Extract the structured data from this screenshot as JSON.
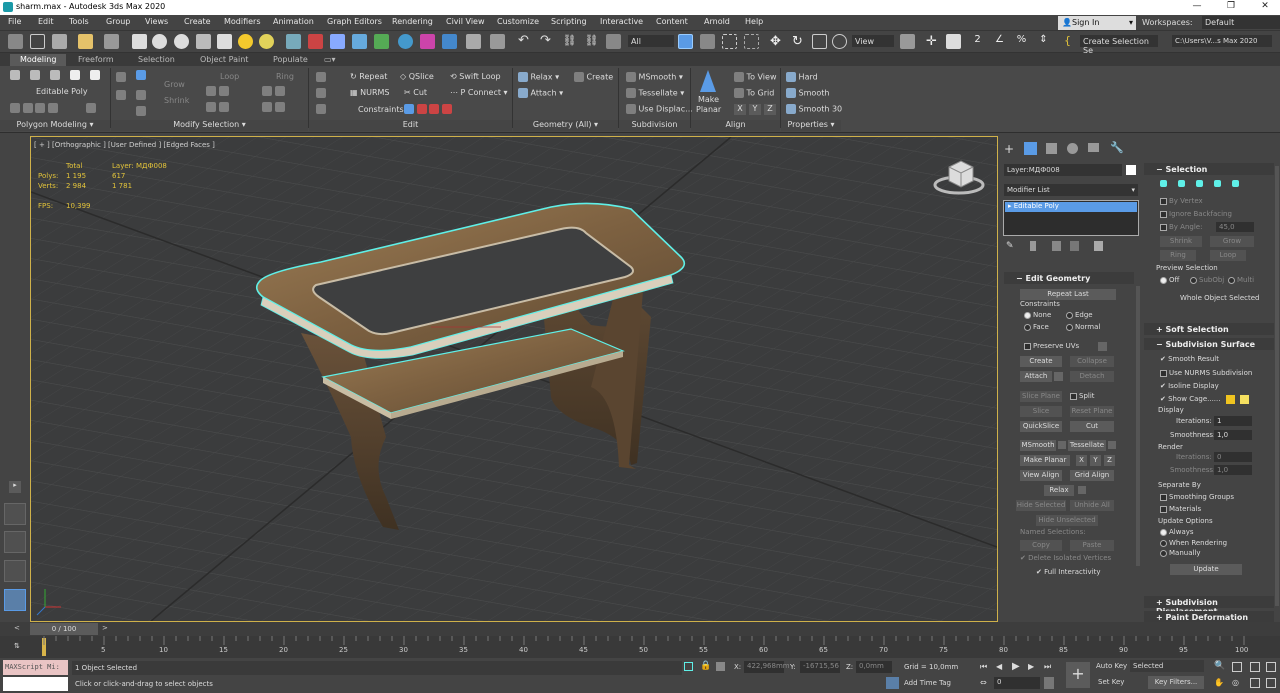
{
  "window": {
    "title": "sharm.max - Autodesk 3ds Max 2020"
  },
  "menu": [
    "File",
    "Edit",
    "Tools",
    "Group",
    "Views",
    "Create",
    "Modifiers",
    "Animation",
    "Graph Editors",
    "Rendering",
    "Civil View",
    "Customize",
    "Scripting",
    "Interactive",
    "Content",
    "Arnold",
    "Help"
  ],
  "account": {
    "sign_in": "Sign In",
    "workspaces_label": "Workspaces:",
    "workspace_value": "Default"
  },
  "toolbar": {
    "filter": "All",
    "view": "View",
    "create_selection_set": "Create Selection Se",
    "path": "C:\\Users\\V...s Max 2020"
  },
  "ribbon_tabs": [
    "Modeling",
    "Freeform",
    "Selection",
    "Object Paint",
    "Populate"
  ],
  "ribbon": {
    "object_type": "Editable Poly",
    "grow": "Grow",
    "shrink": "Shrink",
    "loop": "Loop",
    "ring": "Ring",
    "repeat": "Repeat",
    "qslice": "QSlice",
    "swift_loop": "Swift Loop",
    "nurms": "NURMS",
    "cut": "Cut",
    "p_connect": "P Connect",
    "constraints": "Constraints:",
    "relax": "Relax",
    "create": "Create",
    "attach": "Attach",
    "msmooth": "MSmooth",
    "tessellate": "Tessellate",
    "use_displace": "Use Displac...",
    "make_planar_1": "Make",
    "make_planar_2": "Planar",
    "to_view": "To View",
    "to_grid": "To Grid",
    "x": "X",
    "y": "Y",
    "z": "Z",
    "hard": "Hard",
    "smooth": "Smooth",
    "smooth30": "Smooth 30",
    "sections": [
      "Polygon Modeling",
      "Modify Selection",
      "Edit",
      "Geometry (All)",
      "Subdivision",
      "Align",
      "Properties"
    ]
  },
  "viewport": {
    "label": "[ + ] [Orthographic ] [User Defined ] [Edged Faces ]",
    "stats": {
      "total": "Total",
      "layer": "Layer: МДФ008",
      "polys_label": "Polys:",
      "polys_total": "1 195",
      "polys_layer": "617",
      "verts_label": "Verts:",
      "verts_total": "2 984",
      "verts_layer": "1 781",
      "fps_label": "FPS:",
      "fps": "10,399"
    }
  },
  "panel": {
    "object_name": "Layer:МДФ008",
    "modifier_list": "Modifier List",
    "stack_item": "Editable Poly",
    "edit_geometry": {
      "title": "Edit Geometry",
      "repeat_last": "Repeat Last",
      "constraints": "Constraints",
      "none": "None",
      "edge": "Edge",
      "face": "Face",
      "normal": "Normal",
      "preserve_uvs": "Preserve UVs",
      "create": "Create",
      "collapse": "Collapse",
      "attach": "Attach",
      "detach": "Detach",
      "slice_plane": "Slice Plane",
      "split": "Split",
      "slice": "Slice",
      "reset_plane": "Reset Plane",
      "quickslice": "QuickSlice",
      "cut": "Cut",
      "msmooth": "MSmooth",
      "tessellate": "Tessellate",
      "make_planar": "Make Planar",
      "x": "X",
      "y": "Y",
      "z": "Z",
      "view_align": "View Align",
      "grid_align": "Grid Align",
      "relax": "Relax",
      "hide_selected": "Hide Selected",
      "unhide_all": "Unhide All",
      "hide_unselected": "Hide Unselected",
      "named_selections": "Named Selections:",
      "copy": "Copy",
      "paste": "Paste",
      "delete_isolated": "Delete Isolated Vertices",
      "full_interactivity": "Full Interactivity"
    },
    "selection": {
      "title": "Selection",
      "by_vertex": "By Vertex",
      "ignore_backfacing": "Ignore Backfacing",
      "by_angle": "By Angle:",
      "angle": "45,0",
      "shrink": "Shrink",
      "grow": "Grow",
      "ring": "Ring",
      "loop": "Loop",
      "preview_selection": "Preview Selection",
      "off": "Off",
      "subobj": "SubObj",
      "multi": "Multi",
      "whole_object": "Whole Object Selected"
    },
    "soft_selection": "Soft Selection",
    "subdivision": {
      "title": "Subdivision Surface",
      "smooth_result": "Smooth Result",
      "use_nurms": "Use NURMS Subdivision",
      "isoline": "Isoline Display",
      "show_cage": "Show Cage......",
      "display": "Display",
      "iterations": "Iterations:",
      "iter_val": "1",
      "smoothness": "Smoothness:",
      "smooth_val": "1,0",
      "render": "Render",
      "r_iterations": "Iterations:",
      "r_iter_val": "0",
      "r_smoothness": "Smoothness:",
      "r_smooth_val": "1,0",
      "separate_by": "Separate By",
      "smoothing_groups": "Smoothing Groups",
      "materials": "Materials",
      "update_options": "Update Options",
      "always": "Always",
      "when_rendering": "When Rendering",
      "manually": "Manually",
      "update": "Update"
    },
    "subdivision_displacement": "Subdivision Displacement",
    "paint_deformation": "Paint Deformation"
  },
  "timeline": {
    "frame_range": "0 / 100",
    "ticks": [
      "5",
      "10",
      "15",
      "20",
      "25",
      "30",
      "35",
      "40",
      "45",
      "50",
      "55",
      "60",
      "65",
      "70",
      "75",
      "80",
      "85",
      "90",
      "95",
      "100"
    ]
  },
  "status": {
    "maxscript": "MAXScript Mi:",
    "objects_selected": "1 Object Selected",
    "prompt": "Click or click-and-drag to select objects",
    "x_label": "X:",
    "x": "422,968mm",
    "y_label": "Y:",
    "y": "-16715,56",
    "z_label": "Z:",
    "z": "0,0mm",
    "grid": "Grid = 10,0mm",
    "add_time_tag": "Add Time Tag",
    "frame": "0",
    "auto_key": "Auto Key",
    "selected": "Selected",
    "set_key": "Set Key",
    "key_filters": "Key Filters..."
  },
  "colors": {
    "accent": "#5a9be6",
    "cage": "#5ff0e8",
    "selection_yellow": "#e3c43a",
    "viewport_border": "#cfb14a"
  }
}
